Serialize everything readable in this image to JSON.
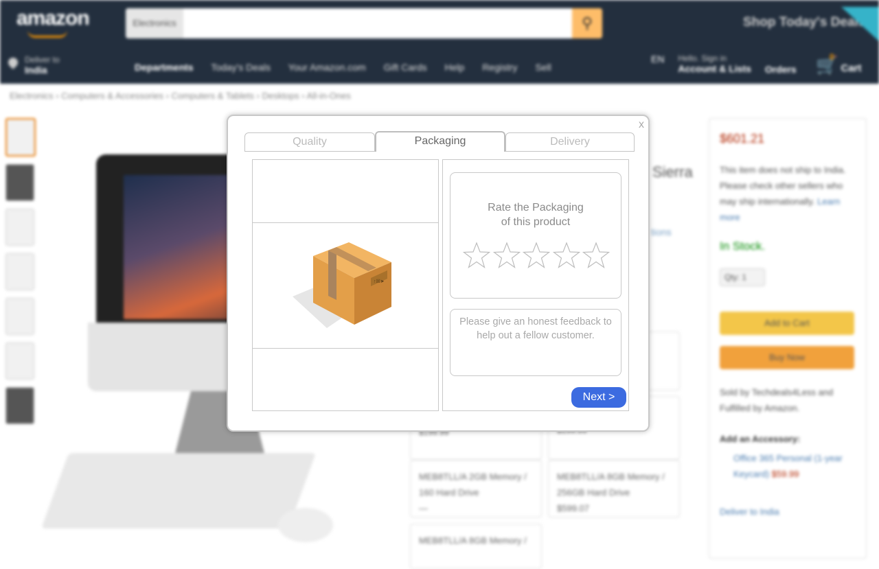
{
  "header": {
    "logo_text": "amazon",
    "search_category": "Electronics",
    "deals_label": "Shop Today's Deals",
    "deliver_line1": "Deliver to",
    "deliver_line2": "India",
    "nav_links": [
      "Departments",
      "Today's Deals",
      "Your Amazon.com",
      "Gift Cards",
      "Help",
      "Registry",
      "Sell"
    ],
    "lang_label": "EN",
    "account_line1": "Hello. Sign in",
    "account_line2": "Account & Lists",
    "orders_label": "Orders",
    "cart_label": "Cart",
    "cart_count": "0"
  },
  "breadcrumb": "Electronics › Computers & Accessories › Computers & Tablets › Desktops › All-in-Ones",
  "product": {
    "title_fragment": "Sierra",
    "link_fragment": "tions"
  },
  "options": [
    {
      "line1": "",
      "line2": "$199.99"
    },
    {
      "line1": "",
      "line2": "$199.99"
    },
    {
      "line1": "MEB8TLL/A 2GB Memory /",
      "line2": "160 Hard Drive",
      "line3": "—"
    },
    {
      "line1": "MEB8TLL/A 8GB Memory /",
      "line2": "256GB Hard Drive",
      "line3": "$599.07"
    },
    {
      "line1": "MEB8TLL/A 8GB Memory /",
      "line2": ""
    }
  ],
  "buybox": {
    "price": "$601.21",
    "ship_text": "This item does not ship to India. Please check other sellers who may ship internationally.",
    "learn_more": "Learn more",
    "stock": "In Stock.",
    "qty": "Qty: 1",
    "add_to_cart": "Add to Cart",
    "buy_now": "Buy Now",
    "sold_by": "Sold by Techdeals4Less and Fulfilled by Amazon.",
    "accessory_title": "Add an Accessory:",
    "accessory_item": "Office 365 Personal (1-year Keycard)",
    "accessory_price": "$59.99",
    "deliver_link": "Deliver to India"
  },
  "modal": {
    "close_label": "x",
    "tabs": [
      {
        "label": "Quality"
      },
      {
        "label": "Packaging"
      },
      {
        "label": "Delivery"
      }
    ],
    "active_tab": "Packaging",
    "rating_prompt": "Rate the  Packaging\nof this product",
    "star_count": 5,
    "rating_value": 0,
    "feedback_placeholder": "Please give an honest feedback to help out a fellow customer.",
    "next_label": "Next >",
    "accent_color": "#3c6be0",
    "box_illustration": "cardboard-box-icon"
  }
}
